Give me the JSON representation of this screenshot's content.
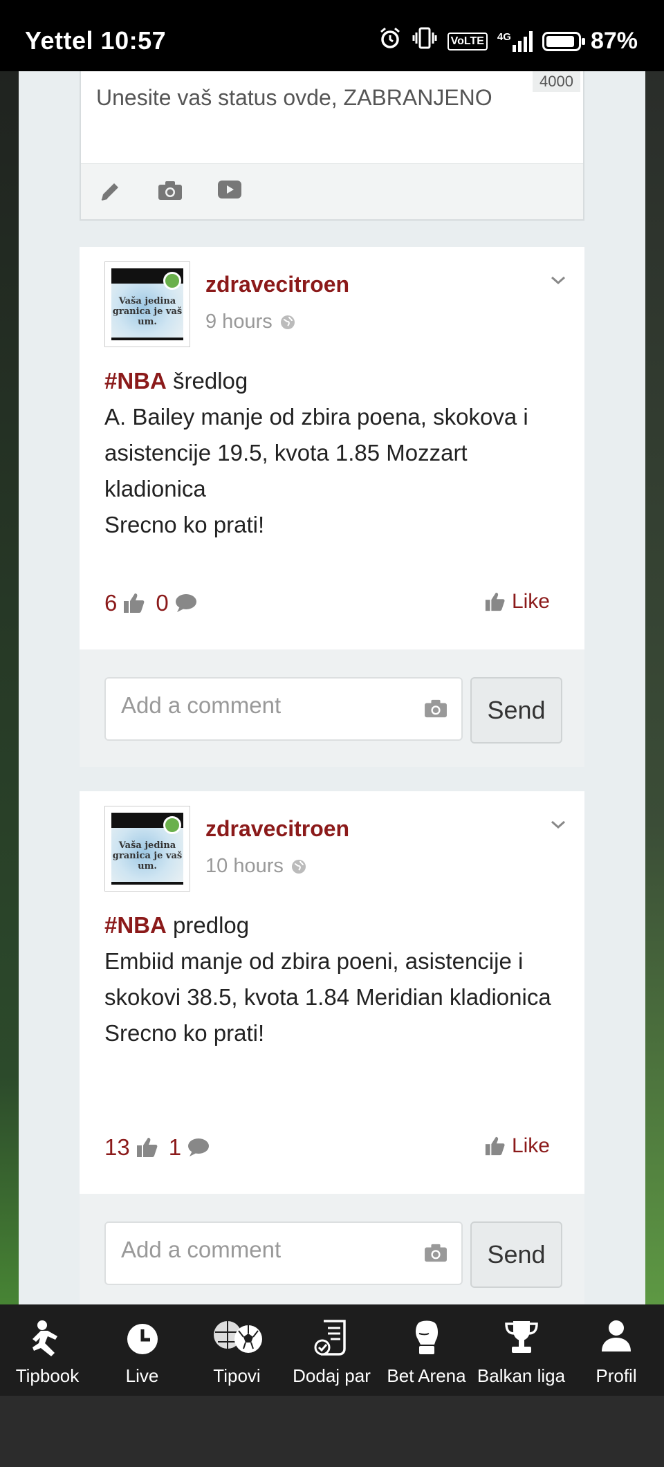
{
  "statusbar": {
    "carrier_time": "Yettel 10:57",
    "volte": "VoLTE",
    "network": "4G",
    "battery": "87%"
  },
  "composer": {
    "placeholder": "Unesite vaš status ovde, ZABRANJENO",
    "char_count": "4000",
    "tools": [
      "pencil-icon",
      "camera-icon",
      "video-icon"
    ]
  },
  "posts": [
    {
      "username": "zdravecitroen",
      "time": "9 hours",
      "avatar_text": "Vaša jedina granica je vaš um.",
      "hashtag": "#NBA",
      "after_tag": " šredlog",
      "lines": [
        "A. Bailey manje od zbira poena, skokova i asistencije 19.5, kvota 1.85 Mozzart kladionica",
        "Srecno ko prati!"
      ],
      "likes": "6",
      "comments": "0",
      "like_label": "Like"
    },
    {
      "username": "zdravecitroen",
      "time": "10 hours",
      "avatar_text": "Vaša jedina granica je vaš um.",
      "hashtag": "#NBA",
      "after_tag": " predlog",
      "lines": [
        "Embiid manje od zbira poeni, asistencije i skokovi 38.5, kvota 1.84 Meridian kladionica",
        "Srecno ko prati!"
      ],
      "likes": "13",
      "comments": "1",
      "like_label": "Like"
    }
  ],
  "comment_box": {
    "placeholder": "Add a comment",
    "send_label": "Send"
  },
  "nav": [
    {
      "label": "Tipbook",
      "icon": "player-icon"
    },
    {
      "label": "Live",
      "icon": "clock-icon"
    },
    {
      "label": "Tipovi",
      "icon": "balls-icon"
    },
    {
      "label": "Dodaj par",
      "icon": "ticket-icon"
    },
    {
      "label": "Bet Arena",
      "icon": "glove-icon"
    },
    {
      "label": "Balkan liga",
      "icon": "trophy-icon"
    },
    {
      "label": "Profil",
      "icon": "user-icon"
    }
  ],
  "colors": {
    "accent": "#8b1a1a",
    "online": "#6ab04c",
    "nav_bg": "#1d1d1d"
  }
}
